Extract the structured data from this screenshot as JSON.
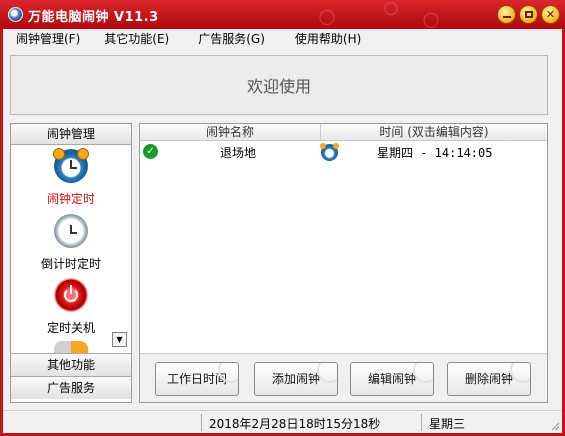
{
  "window": {
    "title": "万能电脑闹钟 V11.3",
    "controls": [
      "minimize-icon",
      "maximize-icon",
      "close-icon"
    ]
  },
  "menu": {
    "items": [
      {
        "label": "闹钟管理(F)"
      },
      {
        "label": "其它功能(E)"
      },
      {
        "label": "广告服务(G)"
      },
      {
        "label": "使用帮助(H)"
      }
    ]
  },
  "banner": {
    "text": "欢迎使用"
  },
  "sidebar": {
    "header": "闹钟管理",
    "items": [
      {
        "label": "闹钟定时",
        "icon": "alarm-clock-icon",
        "active": true
      },
      {
        "label": "倒计时定时",
        "icon": "clock-icon",
        "active": false
      },
      {
        "label": "定时关机",
        "icon": "power-icon",
        "active": false
      },
      {
        "label": "",
        "icon": "misc-tool-icon",
        "active": false
      }
    ],
    "sections": [
      "其他功能",
      "广告服务"
    ]
  },
  "alarm_table": {
    "columns": [
      "闹钟名称",
      "时间 (双击编辑内容)"
    ],
    "rows": [
      {
        "enabled": true,
        "name": "退场地",
        "time": "星期四 - 14:14:05"
      }
    ]
  },
  "buttons": {
    "workday": "工作日时间",
    "add": "添加闹钟",
    "edit": "编辑闹钟",
    "delete": "删除闹钟"
  },
  "status": {
    "datetime": "2018年2月28日18时15分18秒",
    "weekday": "星期三"
  },
  "colors": {
    "titlebar": "#c0141b",
    "active_nav": "#d01010",
    "enabled_check": "#1b9a25"
  }
}
